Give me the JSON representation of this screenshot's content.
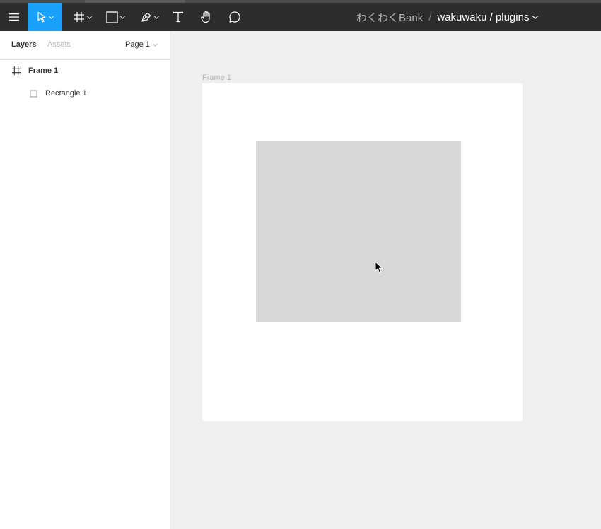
{
  "toolbar": {
    "tools": {
      "menu": "hamburger-icon",
      "move": "move-arrow-icon",
      "frame": "frame-hash-icon",
      "shape": "rectangle-icon",
      "pen": "pen-icon",
      "text": "text-icon",
      "hand": "hand-icon",
      "comment": "comment-icon"
    },
    "active_tool": "move",
    "accent_color": "#18a0fb"
  },
  "breadcrumb": {
    "team": "わくわくBank",
    "separator": "/",
    "file": "wakuwaku / plugins"
  },
  "left_panel": {
    "tabs": {
      "layers": "Layers",
      "assets": "Assets"
    },
    "page": "Page 1",
    "layers": [
      {
        "name": "Frame 1",
        "icon": "frame-hash-icon"
      },
      {
        "name": "Rectangle 1",
        "icon": "rectangle-outline-icon"
      }
    ]
  },
  "canvas": {
    "frame_label": "Frame 1",
    "background_color": "#efefef",
    "rectangle_fill": "#d8d8d8"
  }
}
